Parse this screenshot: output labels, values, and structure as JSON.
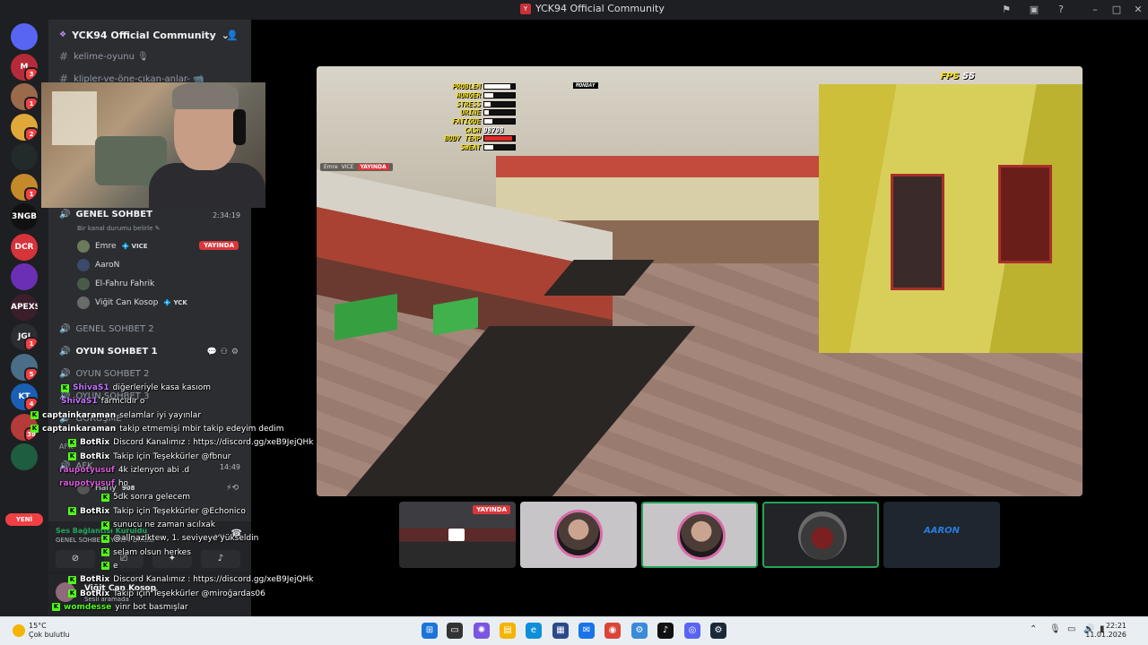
{
  "window": {
    "title": "YCK94 Official Community"
  },
  "rail": {
    "items": [
      {
        "label": "",
        "color": "#5865f2",
        "badge": ""
      },
      {
        "label": "M",
        "color": "#b52b3a",
        "badge": "3"
      },
      {
        "label": "",
        "color": "#9a6a4a",
        "badge": "1"
      },
      {
        "label": "",
        "color": "#e0a838",
        "badge": "2"
      },
      {
        "label": "",
        "color": "#222a2a",
        "badge": ""
      },
      {
        "label": "",
        "color": "#c48a2a",
        "badge": "1"
      },
      {
        "label": "3NGB",
        "color": "#111111",
        "badge": ""
      },
      {
        "label": "DCR",
        "color": "#d6333a",
        "badge": ""
      },
      {
        "label": "",
        "color": "#6b2fb5",
        "badge": ""
      },
      {
        "label": "APEXS",
        "color": "#3a1f2a",
        "badge": ""
      },
      {
        "label": "JGI",
        "color": "#2b2d31",
        "badge": "1"
      },
      {
        "label": "",
        "color": "#4a6d88",
        "badge": "5"
      },
      {
        "label": "KT",
        "color": "#1a5fb4",
        "badge": "4"
      },
      {
        "label": "",
        "color": "#b53a3a",
        "badge": "38"
      },
      {
        "label": "",
        "color": "#1f5d3f",
        "badge": ""
      }
    ],
    "yeni": "YENİ"
  },
  "sidebar": {
    "server_name": "YCK94 Official Community",
    "text_channels": [
      {
        "name": "kelime-oyunu 🎙"
      },
      {
        "name": "klipler-ve-öne-çıkan-anlar- 📹"
      }
    ],
    "voice_active": {
      "name": "GENEL SOHBET",
      "time": "2:34:19",
      "status": "Bir kanal durumu belirle ✎",
      "members": [
        {
          "name": "Emre",
          "tag": "💠 VICE",
          "live": "YAYINDA",
          "color": "#6b7a5a"
        },
        {
          "name": "AaroN",
          "tag": "",
          "live": "",
          "color": "#3a4a6a"
        },
        {
          "name": "El-Fahru Fahrik",
          "tag": "",
          "live": "",
          "color": "#4a5a4a"
        },
        {
          "name": "Viğit Can Kosop",
          "tag": "💠 YCK",
          "live": "",
          "color": "#6a6a6a"
        }
      ]
    },
    "voice_channels": [
      {
        "name": "GENEL SOHBET 2",
        "bold": false
      },
      {
        "name": "OYUN SOHBET 1",
        "bold": true
      },
      {
        "name": "OYUN SOHBET 2",
        "bold": false
      },
      {
        "name": "OYUN SOHBET 3",
        "bold": false
      },
      {
        "name": "GÖRÜŞME",
        "bold": false
      }
    ],
    "afk_label": "AFK",
    "afk_sub": "AFK",
    "afk_time": "14:49",
    "afk_member": "Harly",
    "afk_member_count": "908",
    "voice_status": {
      "title": "Ses Bağlantısı Kuruldu",
      "sub": "GENEL SOHBET / YCK94 Official"
    },
    "user": {
      "name": "Viğit Can Kosop",
      "status": "Sesli aramada"
    }
  },
  "chat": [
    {
      "user": "ShivaS1",
      "color": "#c274ff",
      "msg": "diğerleriyle kasa kasıom",
      "kick": true
    },
    {
      "user": "ShivaS1",
      "color": "#c274ff",
      "msg": "farmcıdır o",
      "kick": false
    },
    {
      "user": "captainkaraman",
      "color": "#ffffff",
      "msg": "selamlar iyi yayınlar",
      "kick": true
    },
    {
      "user": "captainkaraman",
      "color": "#ffffff",
      "msg": "takip etmemişi mbir takip edeyim dedim",
      "kick": true
    },
    {
      "user": "BotRix",
      "color": "#ffffff",
      "msg": "Discord Kanalımız : https://discord.gg/xeB9JejQHk",
      "kick": true
    },
    {
      "user": "BotRix",
      "color": "#ffffff",
      "msg": "Takip için Teşekkürler @fbnur",
      "kick": true
    },
    {
      "user": "raupotyusuf",
      "color": "#d95cd9",
      "msg": "4k izlenyon abi .d",
      "kick": false
    },
    {
      "user": "raupotyusuf",
      "color": "#d95cd9",
      "msg": "ho",
      "kick": false
    },
    {
      "user": "",
      "color": "#ffffff",
      "msg": "5dk sonra gelecem",
      "kick": true
    },
    {
      "user": "BotRix",
      "color": "#ffffff",
      "msg": "Takip için Teşekkürler @Echonico",
      "kick": true
    },
    {
      "user": "",
      "color": "#ffffff",
      "msg": "sunucu ne zaman acılxak",
      "kick": true
    },
    {
      "user": "",
      "color": "#ffffff",
      "msg": "@allnazlktew, 1. seviyeye yükseldin",
      "kick": true
    },
    {
      "user": "",
      "color": "#ffffff",
      "msg": "selam olsun herkes",
      "kick": true
    },
    {
      "user": "",
      "color": "#ffffff",
      "msg": "e",
      "kick": true
    },
    {
      "user": "BotRix",
      "color": "#ffffff",
      "msg": "Discord Kanalımız : https://discord.gg/xeB9JejQHk",
      "kick": true
    },
    {
      "user": "BotRix",
      "color": "#ffffff",
      "msg": "Takip için Teşekkürler @miroğardas06",
      "kick": true
    },
    {
      "user": "womdesse",
      "color": "#53fc18",
      "msg": "yinr bot basmışlar",
      "kick": true
    }
  ],
  "game": {
    "day": "MONDAY",
    "fps_label": "FPS",
    "fps_value": "55",
    "hud": [
      {
        "label": "PROBLEM",
        "fill": 0.85,
        "value": ""
      },
      {
        "label": "HUNGER",
        "fill": 0.3,
        "value": ""
      },
      {
        "label": "STRESS",
        "fill": 0.2,
        "value": ""
      },
      {
        "label": "URINE",
        "fill": 0.15,
        "value": ""
      },
      {
        "label": "FATIGUE",
        "fill": 0.25,
        "value": ""
      },
      {
        "label": "CASH",
        "fill": 0,
        "value": "98798"
      },
      {
        "label": "BODY TEMP",
        "fill": 0.9,
        "value": ""
      },
      {
        "label": "SWEAT",
        "fill": 0.3,
        "value": ""
      }
    ],
    "mini_user": "Emre",
    "mini_tag": "VICE",
    "mini_live": "YAYINDA"
  },
  "thumbs": [
    {
      "name": "emre-stream",
      "live": "YAYINDA"
    },
    {
      "name": "aaron-avatar",
      "live": ""
    },
    {
      "name": "el-fahru-avatar",
      "live": ""
    },
    {
      "name": "car-stream",
      "live": ""
    },
    {
      "name": "aaron-logo",
      "live": "",
      "text": "AARON"
    }
  ],
  "taskbar": {
    "temp": "15°C",
    "condition": "Çok bulutlu",
    "time": "22:21",
    "date": "11.01.2026"
  }
}
